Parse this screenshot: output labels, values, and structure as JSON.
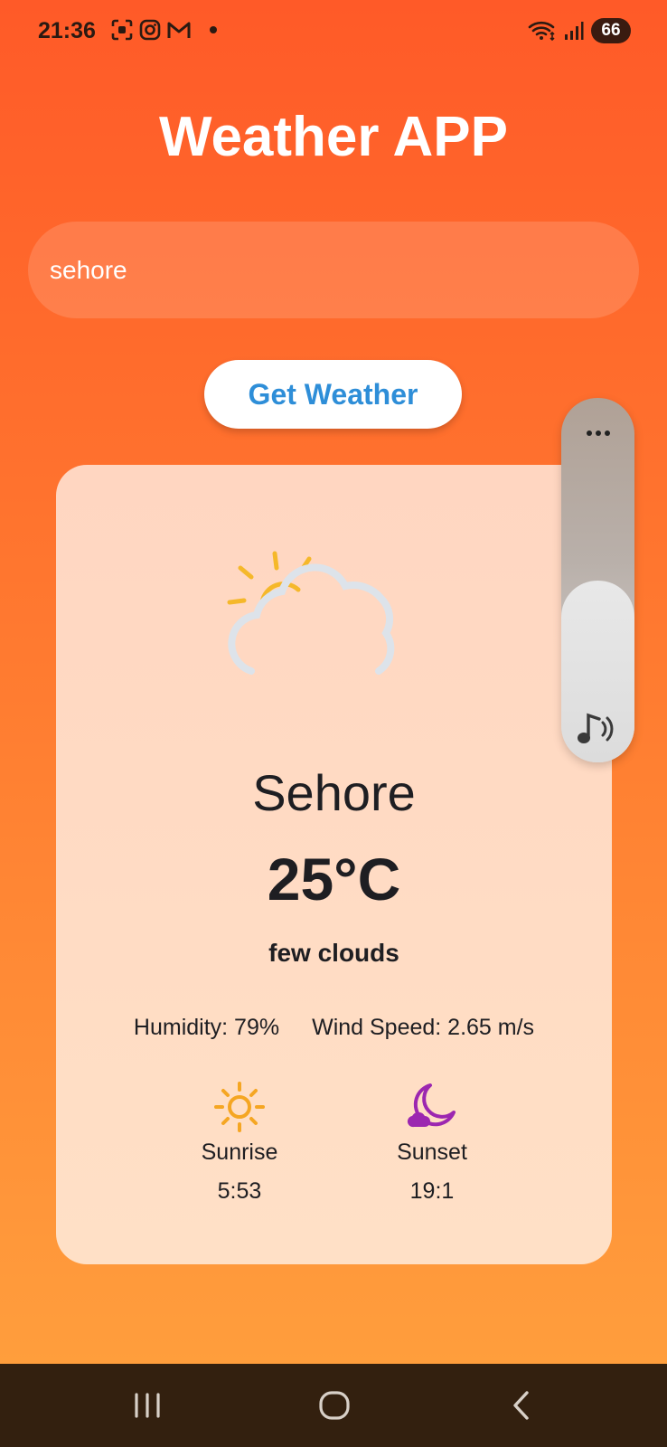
{
  "status_bar": {
    "time": "21:36",
    "battery": "66",
    "left_icons": [
      "screenshot-icon",
      "instagram-icon",
      "gmail-icon",
      "notification-dot"
    ],
    "right_icons": [
      "wifi-icon",
      "signal-icon",
      "battery-icon"
    ]
  },
  "app": {
    "title": "Weather APP"
  },
  "search": {
    "value": "sehore"
  },
  "actions": {
    "get_weather": "Get Weather"
  },
  "weather": {
    "icon": "partly-cloudy-icon",
    "city": "Sehore",
    "temperature": "25°C",
    "description": "few clouds",
    "humidity": "Humidity: 79%",
    "wind": "Wind Speed: 2.65 m/s",
    "sunrise_label": "Sunrise",
    "sunrise_time": "5:53",
    "sunset_label": "Sunset",
    "sunset_time": "19:1"
  },
  "volume": {
    "level": 0.5,
    "icon": "music-volume-icon"
  },
  "colors": {
    "bg_top": "#ff5a28",
    "bg_bottom": "#ffa23e",
    "button_text": "#2e8ed8",
    "sun_yellow": "#f5a623",
    "moon_purple": "#9c27b0",
    "nav_bar": "#33200f"
  }
}
